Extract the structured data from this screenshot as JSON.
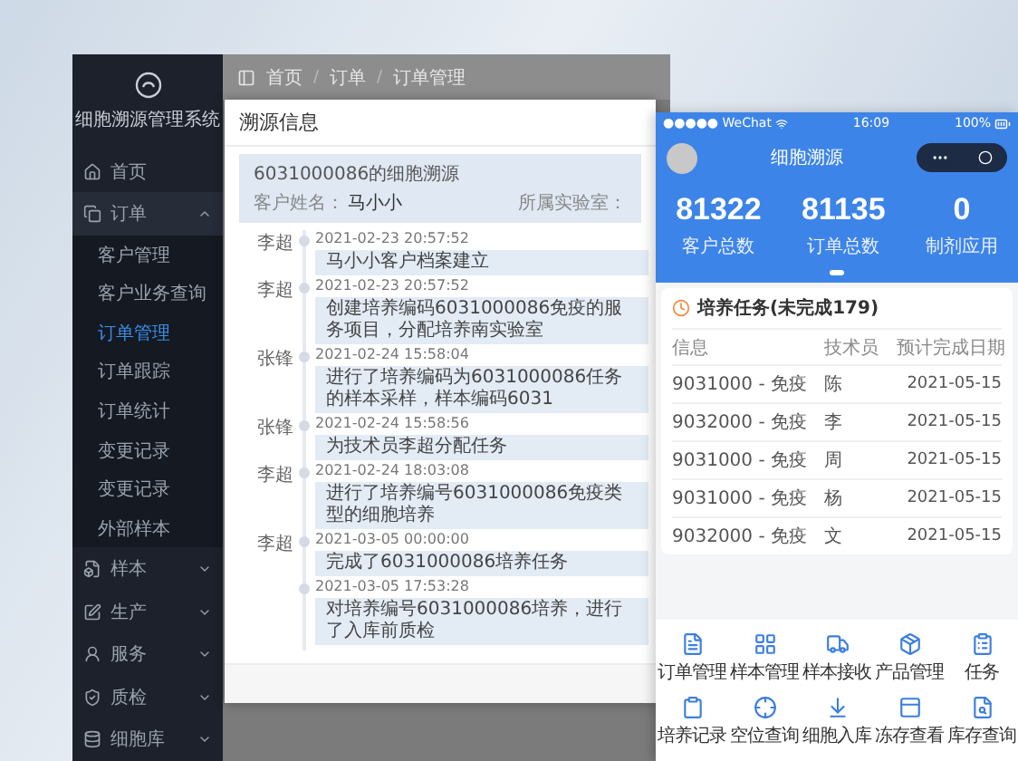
{
  "admin": {
    "app_title": "细胞溯源管理系统",
    "sidebar": [
      {
        "label": "首页",
        "kind": "link"
      },
      {
        "label": "订单",
        "kind": "group",
        "expanded": true,
        "children": [
          {
            "label": "客户管理",
            "selected": false
          },
          {
            "label": "客户业务查询",
            "selected": false
          },
          {
            "label": "订单管理",
            "selected": true
          },
          {
            "label": "订单跟踪",
            "selected": false
          },
          {
            "label": "订单统计",
            "selected": false
          },
          {
            "label": "变更记录",
            "selected": false
          },
          {
            "label": "变更记录",
            "selected": false
          },
          {
            "label": "外部样本",
            "selected": false
          }
        ]
      },
      {
        "label": "样本",
        "kind": "group",
        "expanded": false
      },
      {
        "label": "生产",
        "kind": "group",
        "expanded": false
      },
      {
        "label": "服务",
        "kind": "group",
        "expanded": false
      },
      {
        "label": "质检",
        "kind": "group",
        "expanded": false
      },
      {
        "label": "细胞库",
        "kind": "group",
        "expanded": false
      }
    ],
    "breadcrumb": [
      "首页",
      "订单",
      "订单管理"
    ],
    "breadcrumb_separator": "/"
  },
  "modal": {
    "title": "溯源信息",
    "summary": {
      "heading": "6031000086的细胞溯源",
      "customer_label": "客户姓名：",
      "customer": "马小小",
      "lab_label": "所属实验室："
    },
    "timeline": [
      {
        "person": "李超",
        "time": "2021-02-23 20:57:52",
        "text": "马小小客户档案建立"
      },
      {
        "person": "李超",
        "time": "2021-02-23 20:57:52",
        "text": "创建培养编码6031000086免疫的服务项目，分配培养南实验室"
      },
      {
        "person": "张锋",
        "time": "2021-02-24 15:58:04",
        "text": "进行了培养编码为6031000086任务的样本采样，样本编码6031"
      },
      {
        "person": "张锋",
        "time": "2021-02-24 15:58:56",
        "text": "为技术员李超分配任务"
      },
      {
        "person": "李超",
        "time": "2021-02-24 18:03:08",
        "text": "进行了培养编号6031000086免疫类型的细胞培养"
      },
      {
        "person": "李超",
        "time": "2021-03-05 00:00:00",
        "text": "完成了6031000086培养任务"
      },
      {
        "time": "2021-03-05 17:53:28",
        "text": "对培养编号6031000086培养，进行了入库前质检"
      }
    ]
  },
  "phone": {
    "status": {
      "carrier": "●●●●● WeChat",
      "time": "16:09",
      "battery": "100%"
    },
    "title": "细胞溯源",
    "stats": [
      {
        "value": "81322",
        "label": "客户总数"
      },
      {
        "value": "81135",
        "label": "订单总数"
      },
      {
        "value": "0",
        "label": "制剂应用"
      }
    ],
    "tasks": {
      "title": "培养任务(未完成179)",
      "columns": [
        "信息",
        "技术员",
        "预计完成日期"
      ],
      "rows": [
        [
          "9031000 - 免疫",
          "陈",
          "2021-05-15"
        ],
        [
          "9032000 - 免疫",
          "李",
          "2021-05-15"
        ],
        [
          "9031000 - 免疫",
          "周",
          "2021-05-15"
        ],
        [
          "9031000 - 免疫",
          "杨",
          "2021-05-15"
        ],
        [
          "9032000 - 免疫",
          "文",
          "2021-05-15"
        ]
      ]
    },
    "shortcuts": [
      "订单管理",
      "样本管理",
      "样本接收",
      "产品管理",
      "任务",
      "培养记录",
      "空位查询",
      "细胞入库",
      "冻存查看",
      "库存查询"
    ]
  }
}
